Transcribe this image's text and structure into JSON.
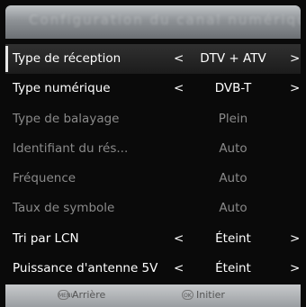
{
  "header": {
    "title": "Configuration du canal numérique"
  },
  "menu": {
    "items": [
      {
        "label": "Type de réception",
        "value": "DTV + ATV",
        "left_arrow": "<",
        "right_arrow": ">",
        "enabled": true,
        "selected": true
      },
      {
        "label": "Type numérique",
        "value": "DVB-T",
        "left_arrow": "<",
        "right_arrow": ">",
        "enabled": true,
        "selected": false
      },
      {
        "label": "Type de balayage",
        "value": "Plein",
        "enabled": false,
        "selected": false
      },
      {
        "label": "Identifiant du rés...",
        "value": "Auto",
        "enabled": false,
        "selected": false
      },
      {
        "label": "Fréquence",
        "value": "Auto",
        "enabled": false,
        "selected": false
      },
      {
        "label": "Taux de symbole",
        "value": "Auto",
        "enabled": false,
        "selected": false
      },
      {
        "label": "Tri par LCN",
        "value": "Éteint",
        "left_arrow": "<",
        "right_arrow": ">",
        "enabled": true,
        "selected": false
      },
      {
        "label": "Puissance d'antenne 5V",
        "value": "Éteint",
        "left_arrow": "<",
        "right_arrow": ">",
        "enabled": true,
        "selected": false
      }
    ]
  },
  "footer": {
    "back_icon": "menu-button-icon",
    "back_icon_text": "MENU",
    "back_label": "Arrière",
    "ok_icon": "ok-button-icon",
    "ok_icon_text": "OK",
    "ok_label": "Initier"
  },
  "colors": {
    "background": "#0a0a0a",
    "enabled_text": "#ffffff",
    "disabled_text": "#8a8a8a",
    "header_gradient_top": "#bfc3c6",
    "footer_bg": "#b4b7ba"
  }
}
